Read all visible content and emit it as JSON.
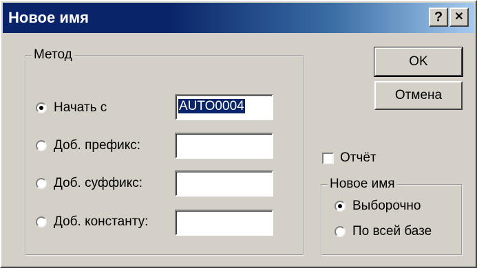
{
  "window": {
    "title": "Новое имя",
    "help_button": "?",
    "close_button": "✕"
  },
  "method_group": {
    "label": "Метод",
    "options": [
      {
        "label": "Начать с",
        "checked": true,
        "field_value": "AUTO0004"
      },
      {
        "label": "Доб. префикс:",
        "checked": false,
        "field_value": ""
      },
      {
        "label": "Доб. суффикс:",
        "checked": false,
        "field_value": ""
      },
      {
        "label": "Доб. константу:",
        "checked": false,
        "field_value": ""
      }
    ]
  },
  "buttons": {
    "ok": "OK",
    "cancel": "Отмена"
  },
  "report_checkbox": {
    "label": "Отчёт",
    "checked": false
  },
  "new_name_group": {
    "label": "Новое имя",
    "options": [
      {
        "label": "Выборочно",
        "checked": true
      },
      {
        "label": "По всей базе",
        "checked": false
      }
    ]
  },
  "colors": {
    "title_bar_start": "#0a246a",
    "title_bar_end": "#a6caf0",
    "dialog_face": "#d4d0c8",
    "selection": "#0a246a"
  }
}
